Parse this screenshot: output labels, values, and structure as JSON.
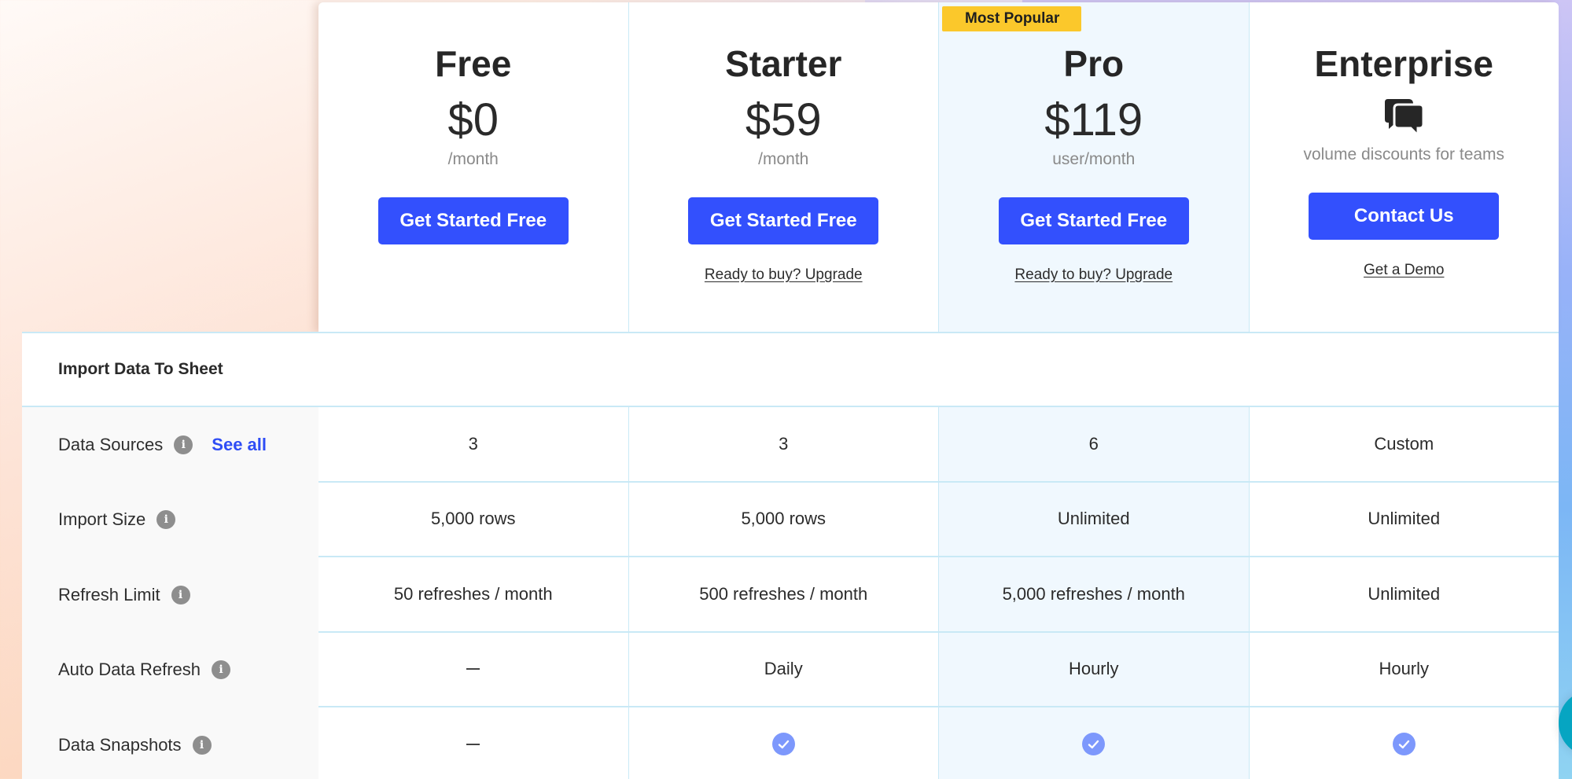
{
  "plans": [
    {
      "name": "Free",
      "price": "$0",
      "period": "/month",
      "cta": "Get Started Free",
      "sub_link": null,
      "badge": null,
      "highlight": false
    },
    {
      "name": "Starter",
      "price": "$59",
      "period": "/month",
      "cta": "Get Started Free",
      "sub_link": "Ready to buy? Upgrade",
      "badge": null,
      "highlight": false
    },
    {
      "name": "Pro",
      "price": "$119",
      "period": "user/month",
      "cta": "Get Started Free",
      "sub_link": "Ready to buy? Upgrade",
      "badge": "Most Popular",
      "highlight": true
    },
    {
      "name": "Enterprise",
      "price_icon": "chat-bubbles-icon",
      "period": "volume discounts for teams",
      "cta": "Contact Us",
      "sub_link": "Get a Demo",
      "badge": null,
      "highlight": false
    }
  ],
  "section": {
    "title": "Import Data To Sheet"
  },
  "features": [
    {
      "label": "Data Sources",
      "info_icon": "info-icon",
      "link": "See all",
      "values": [
        {
          "type": "text",
          "text": "3"
        },
        {
          "type": "text",
          "text": "3"
        },
        {
          "type": "text",
          "text": "6"
        },
        {
          "type": "text",
          "text": "Custom"
        }
      ]
    },
    {
      "label": "Import Size",
      "info_icon": "info-icon",
      "values": [
        {
          "type": "text",
          "text": "5,000 rows"
        },
        {
          "type": "text",
          "text": "5,000 rows"
        },
        {
          "type": "text",
          "text": "Unlimited"
        },
        {
          "type": "text",
          "text": "Unlimited"
        }
      ]
    },
    {
      "label": "Refresh Limit",
      "info_icon": "info-icon",
      "values": [
        {
          "type": "text",
          "text": "50 refreshes / month"
        },
        {
          "type": "text",
          "text": "500 refreshes / month"
        },
        {
          "type": "text",
          "text": "5,000 refreshes / month"
        },
        {
          "type": "text",
          "text": "Unlimited"
        }
      ]
    },
    {
      "label": "Auto Data Refresh",
      "info_icon": "info-icon",
      "values": [
        {
          "type": "dash"
        },
        {
          "type": "text",
          "text": "Daily"
        },
        {
          "type": "text",
          "text": "Hourly"
        },
        {
          "type": "text",
          "text": "Hourly"
        }
      ]
    },
    {
      "label": "Data Snapshots",
      "info_icon": "info-icon",
      "values": [
        {
          "type": "dash"
        },
        {
          "type": "check"
        },
        {
          "type": "check"
        },
        {
          "type": "check"
        }
      ]
    }
  ],
  "info_glyph": "i",
  "colors": {
    "accent": "#3350fd",
    "badge": "#fbc82b",
    "highlight_column": "#f0f8fe",
    "check": "#7d98fc",
    "border": "#c9e9f6",
    "chat_widget": "#06a5c2"
  }
}
